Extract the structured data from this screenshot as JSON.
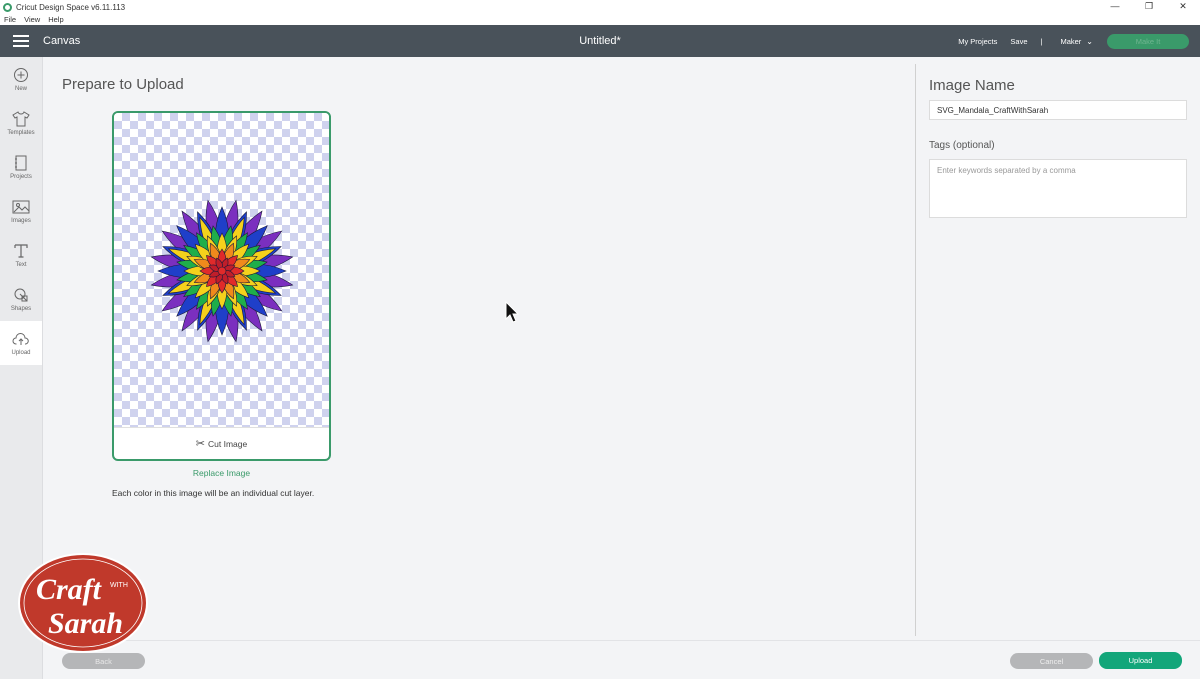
{
  "titlebar": {
    "app_title": "Cricut Design Space  v6.11.113",
    "minimize": "—",
    "restore": "❐",
    "close": "✕"
  },
  "menu": [
    "File",
    "View",
    "Help"
  ],
  "header": {
    "section": "Canvas",
    "doc_title": "Untitled*",
    "my_projects": "My Projects",
    "save": "Save",
    "separator": "|",
    "machine": "Maker",
    "make_it": "Make It"
  },
  "sidebar": {
    "items": [
      {
        "label": "New",
        "icon": "plus-circle-icon"
      },
      {
        "label": "Templates",
        "icon": "tshirt-icon"
      },
      {
        "label": "Projects",
        "icon": "notebook-icon"
      },
      {
        "label": "Images",
        "icon": "image-icon"
      },
      {
        "label": "Text",
        "icon": "text-t-icon"
      },
      {
        "label": "Shapes",
        "icon": "shapes-icon"
      },
      {
        "label": "Upload",
        "icon": "cloud-upload-icon"
      }
    ],
    "active": "Upload"
  },
  "main": {
    "title": "Prepare to Upload",
    "cut_image": "Cut Image",
    "replace_image": "Replace Image",
    "note": "Each color in this image will be an individual cut layer."
  },
  "right_panel": {
    "title": "Image Name",
    "image_name_value": "SVG_Mandala_CraftWithSarah",
    "tags_label": "Tags (optional)",
    "tags_placeholder": "Enter keywords separated by a comma"
  },
  "footer": {
    "back": "Back",
    "cancel": "Cancel",
    "upload": "Upload"
  },
  "watermark": {
    "line1": "Craft",
    "line2": "WITH",
    "line3": "Sarah"
  },
  "colors": {
    "header_bg": "#49525a",
    "accent_green": "#3a9a6a",
    "upload_green": "#13a67a"
  }
}
